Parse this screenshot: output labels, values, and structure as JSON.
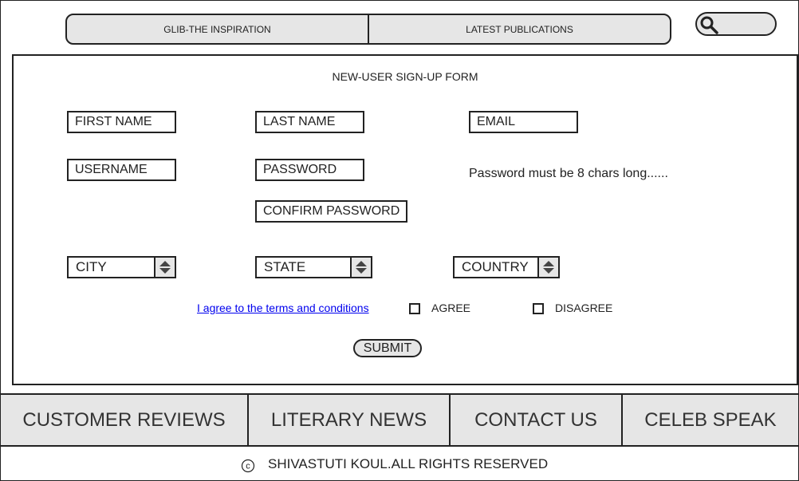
{
  "topnav": {
    "tabs": [
      {
        "label": "GLIB-THE INSPIRATION"
      },
      {
        "label": "LATEST PUBLICATIONS"
      }
    ]
  },
  "search": {
    "icon": "search-icon",
    "value": ""
  },
  "form": {
    "title": "NEW-USER SIGN-UP FORM",
    "first_name": "FIRST NAME",
    "last_name": "LAST NAME",
    "email": "EMAIL",
    "username": "USERNAME",
    "password": "PASSWORD",
    "confirm_password": "CONFIRM PASSWORD",
    "password_hint": "Password must be 8 chars long......",
    "city": "CITY",
    "state": "STATE",
    "country": "COUNTRY",
    "terms_link": "I agree to the terms and conditions",
    "agree_label": "AGREE",
    "disagree_label": "DISAGREE",
    "agree_checked": false,
    "disagree_checked": false,
    "submit_label": "SUBMIT"
  },
  "bottomnav": {
    "items": [
      {
        "label": "CUSTOMER REVIEWS"
      },
      {
        "label": "LITERARY NEWS"
      },
      {
        "label": "CONTACT US"
      },
      {
        "label": "CELEB SPEAK"
      }
    ]
  },
  "footer": {
    "copyright_symbol": "©",
    "text": "SHIVASTUTI KOUL.ALL RIGHTS RESERVED"
  },
  "colors": {
    "panel_fill": "#e6e6e6",
    "border": "#222222",
    "link": "#0000ee"
  }
}
